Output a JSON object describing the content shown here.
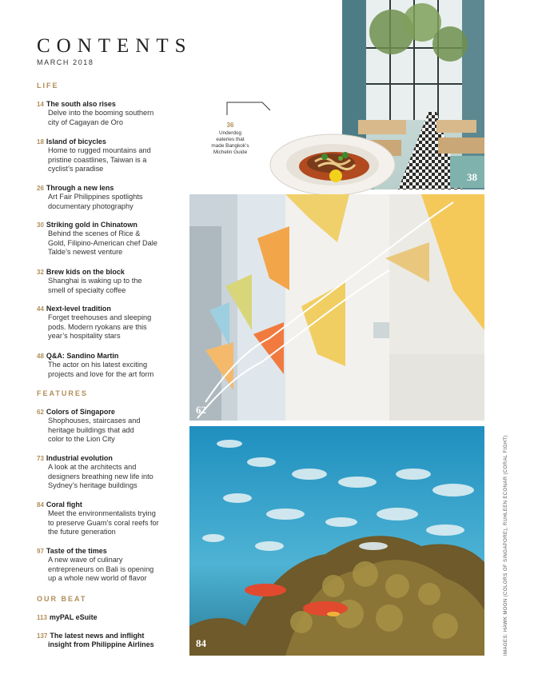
{
  "header": {
    "title": "CONTENTS",
    "date": "MARCH 2018"
  },
  "sections": {
    "life": "LIFE",
    "features": "FEATURES",
    "our_beat": "OUR BEAT"
  },
  "life": [
    {
      "page": "14",
      "title": "The south also rises",
      "desc": [
        "Delve into the booming southern",
        "city of Cagayan de Oro"
      ]
    },
    {
      "page": "18",
      "title": "Island of bicycles",
      "desc": [
        "Home to rugged mountains and",
        "pristine coastlines, Taiwan is a",
        "cyclist’s paradise"
      ]
    },
    {
      "page": "26",
      "title": "Through a new lens",
      "desc": [
        "Art Fair Philippines spotlights",
        "documentary photography"
      ]
    },
    {
      "page": "30",
      "title": "Striking gold in Chinatown",
      "desc": [
        "Behind the scenes of Rice &",
        "Gold, Filipino-American chef Dale",
        "Talde’s newest venture"
      ]
    },
    {
      "page": "32",
      "title": "Brew kids on the block",
      "desc": [
        "Shanghai is waking up to the",
        "smell of specialty coffee"
      ]
    },
    {
      "page": "44",
      "title": "Next-level tradition",
      "desc": [
        "Forget treehouses and sleeping",
        "pods. Modern ryokans are this",
        "year’s hospitality stars"
      ]
    },
    {
      "page": "48",
      "title": "Q&A: Sandino Martin",
      "desc": [
        "The actor on his latest exciting",
        "projects and love for the art form"
      ]
    }
  ],
  "features": [
    {
      "page": "62",
      "title": "Colors of Singapore",
      "desc": [
        "Shophouses, staircases and",
        "heritage buildings that add",
        "color to the Lion City"
      ]
    },
    {
      "page": "73",
      "title": "Industrial evolution",
      "desc": [
        "A look at the architects and",
        "designers breathing new life into",
        "Sydney’s heritage buildings"
      ]
    },
    {
      "page": "84",
      "title": "Coral fight",
      "desc": [
        "Meet the environmentalists trying",
        "to preserve Guam’s coral reefs for",
        "the future generation"
      ]
    },
    {
      "page": "97",
      "title": "Taste of the times",
      "desc": [
        "A new wave of culinary",
        "entrepreneurs on Bali is opening",
        "up a whole new world of flavor"
      ]
    }
  ],
  "our_beat": [
    {
      "page": "113",
      "title": "myPAL eSuite"
    },
    {
      "page": "137",
      "title": "The latest news and inflight",
      "title2": "insight from Philippine Airlines"
    }
  ],
  "callout": {
    "page": "36",
    "text": [
      "Underdog",
      "eateries that",
      "made Bangkok’s",
      "Michelin Guide"
    ]
  },
  "photos": {
    "restaurant_page": "38",
    "stairs_page": "62",
    "coral_page": "84"
  },
  "credit": "IMAGES: HAWK MOON (COLORS OF SINGAPORE), RUHLEEN ECONAR (CORAL FIGHT)",
  "colors": {
    "accent": "#b08d57"
  }
}
